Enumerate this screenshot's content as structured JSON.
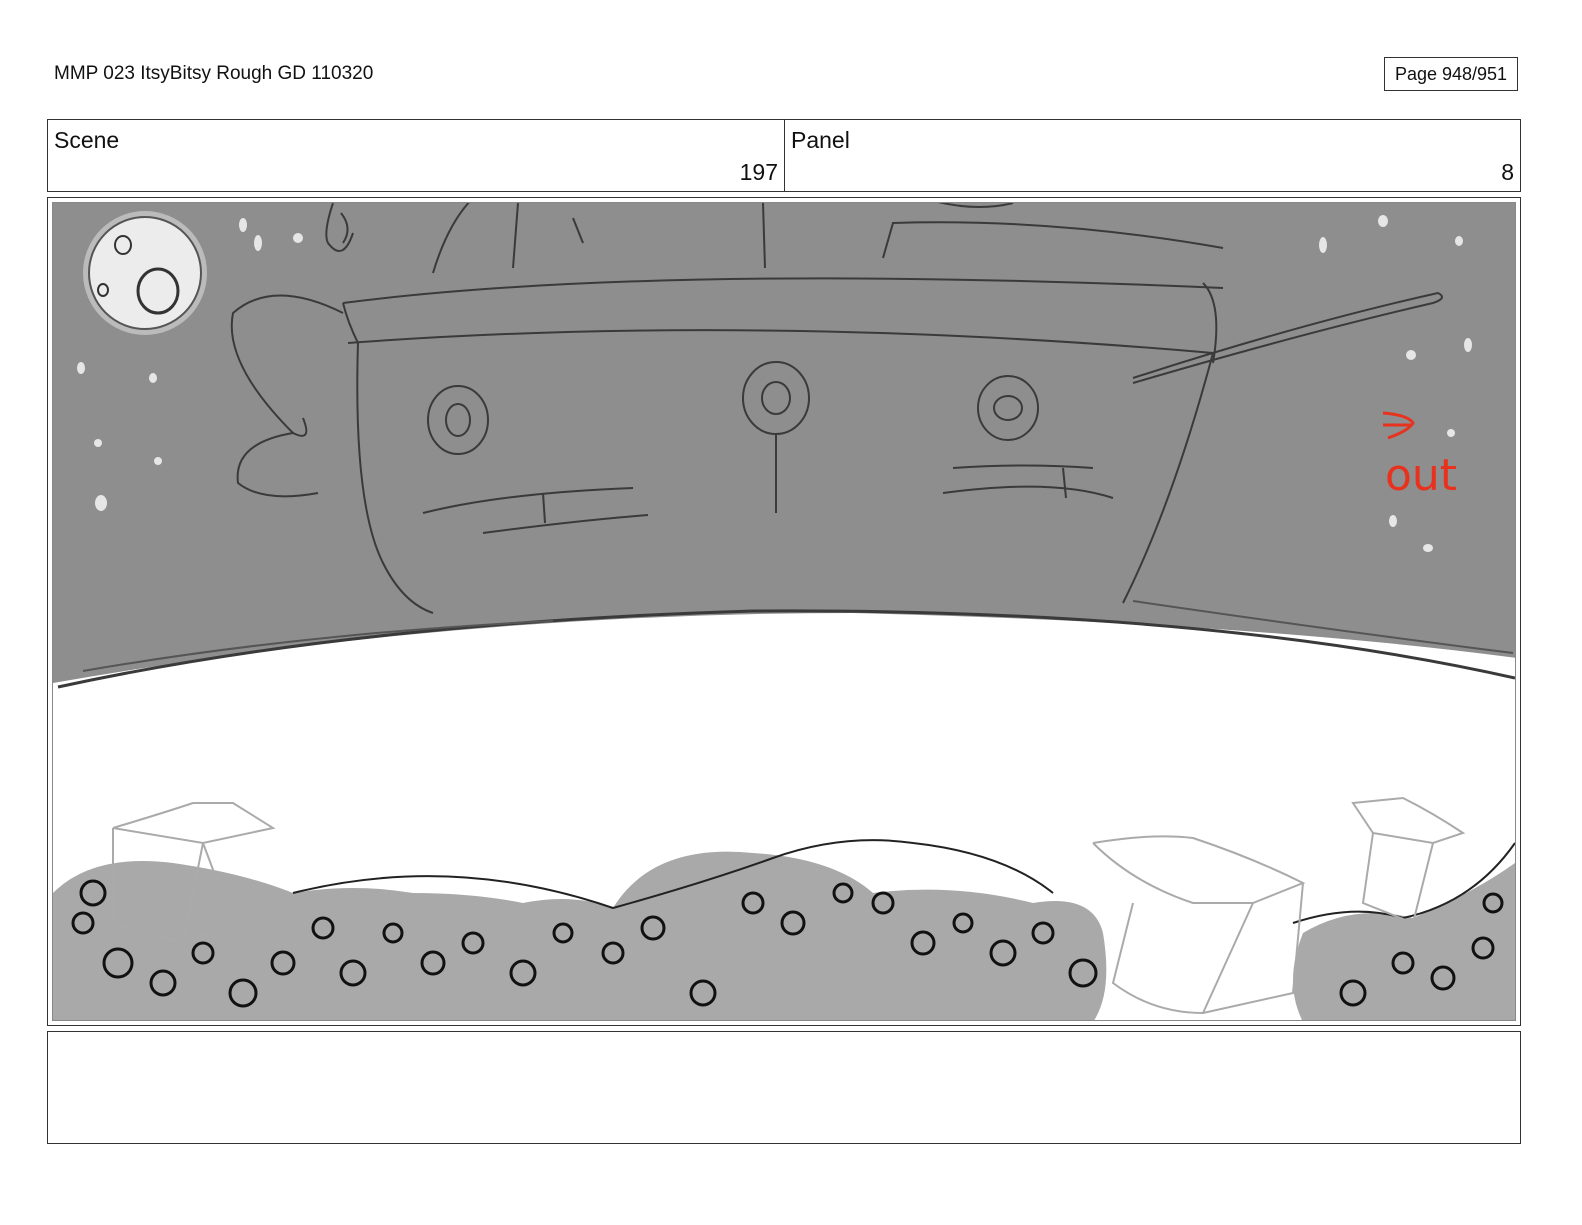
{
  "header": {
    "doc_title": "MMP 023 ItsyBitsy Rough GD 110320",
    "page_label": "Page 948/951"
  },
  "info": {
    "scene_label": "Scene",
    "scene_value": "197",
    "panel_label": "Panel",
    "panel_value": "8"
  },
  "drawing": {
    "annotation": "out",
    "sky_color": "#8e8e8e",
    "annotation_color": "#e8321e"
  },
  "notes": {
    "text": ""
  }
}
